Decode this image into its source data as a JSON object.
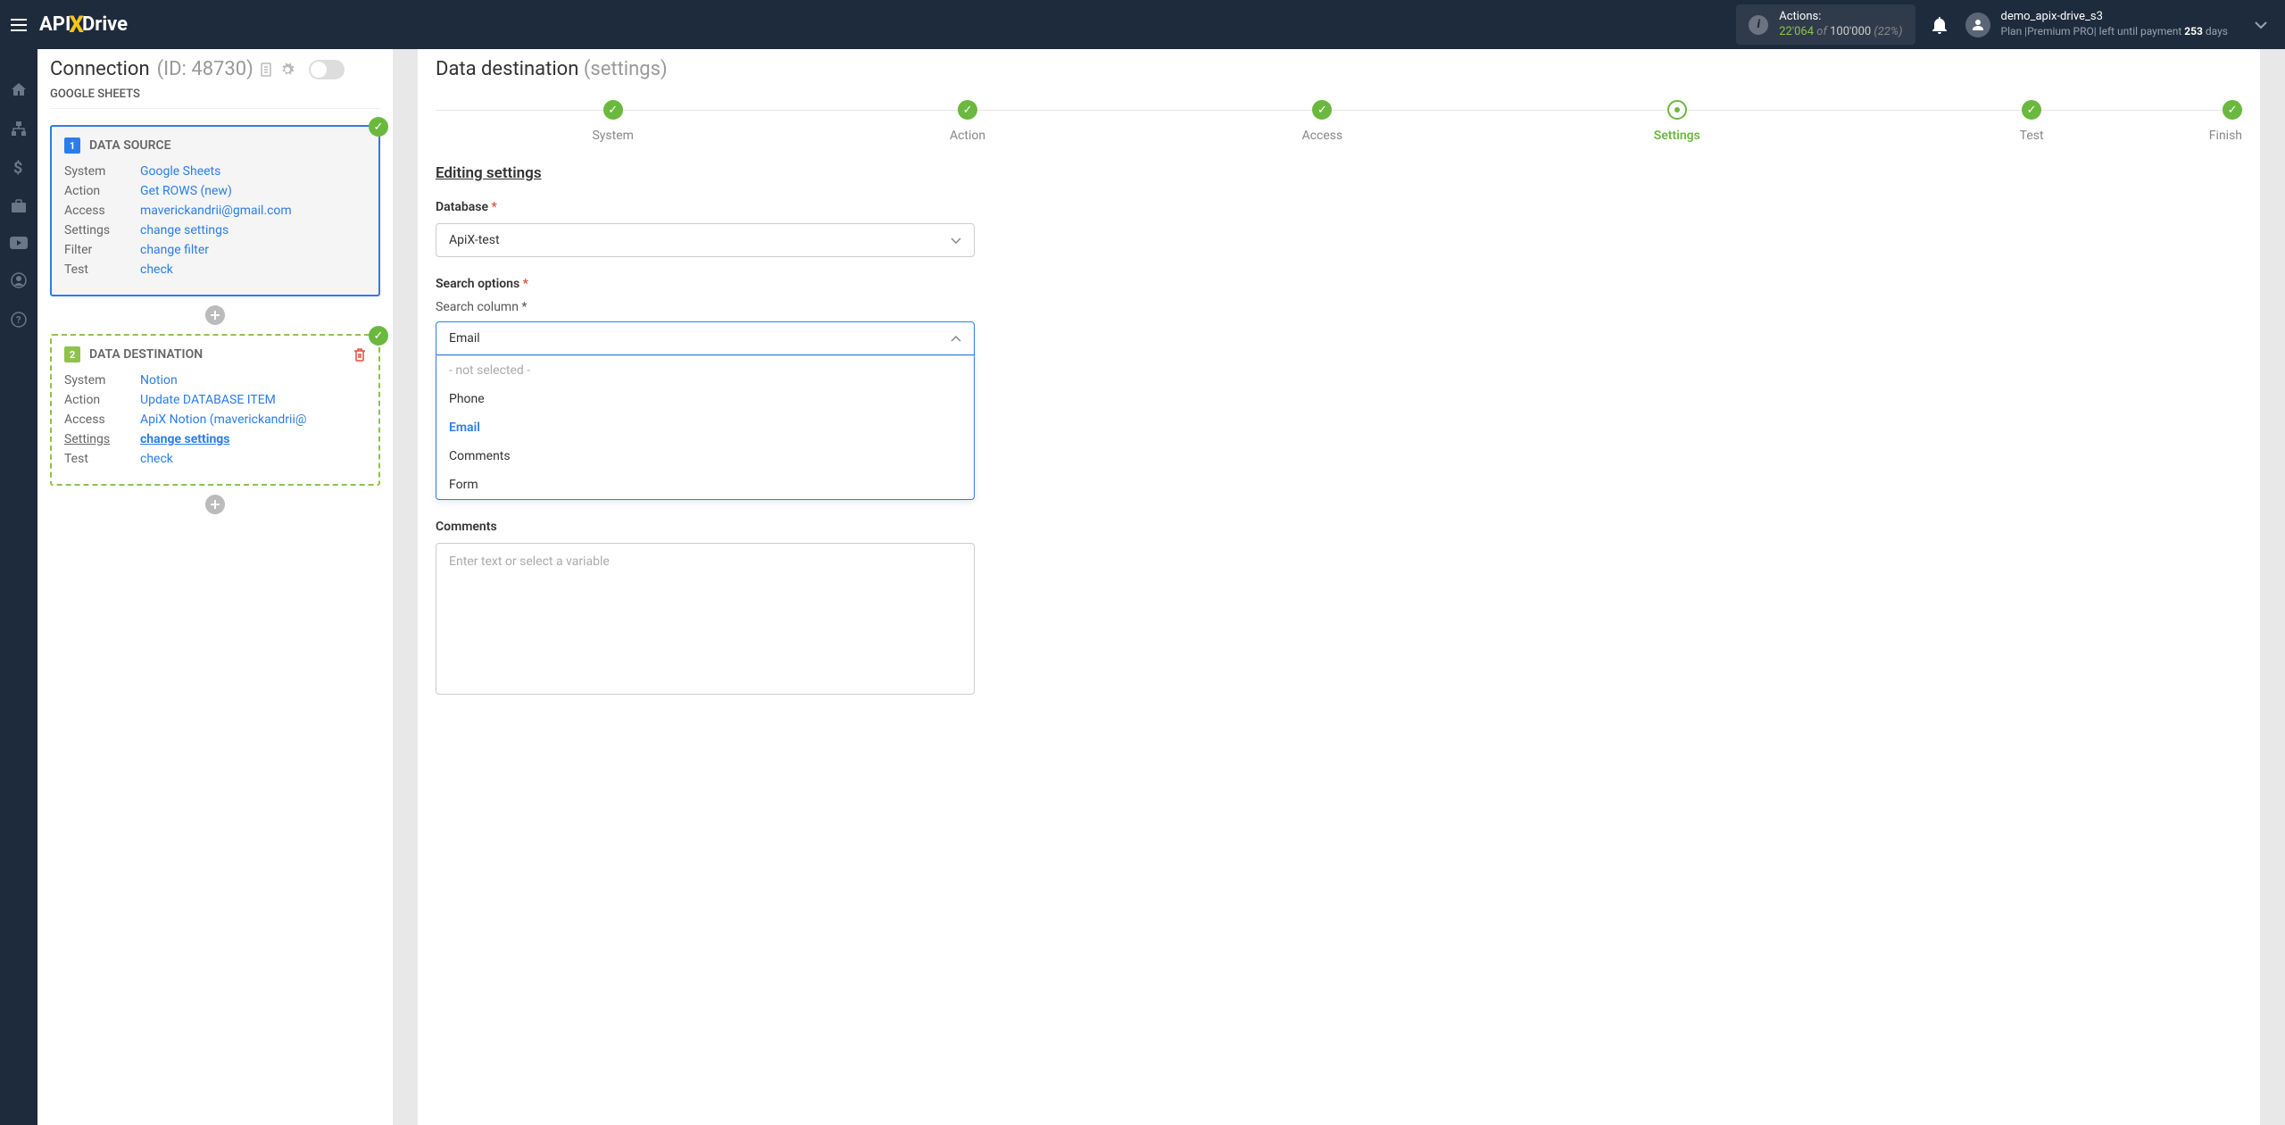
{
  "header": {
    "logo": {
      "api": "API",
      "x": "X",
      "drive": "Drive"
    },
    "actions": {
      "label": "Actions:",
      "used": "22'064",
      "of": "of",
      "total": "100'000",
      "pct": "(22%)"
    },
    "user": {
      "name": "demo_apix-drive_s3",
      "plan_prefix": "Plan |Premium PRO| left until payment ",
      "days": "253",
      "days_suffix": " days"
    }
  },
  "connection": {
    "title": "Connection",
    "id": "(ID: 48730)",
    "sheets": "GOOGLE SHEETS",
    "source": {
      "num": "1",
      "title": "DATA SOURCE",
      "rows": [
        {
          "label": "System",
          "value": "Google Sheets"
        },
        {
          "label": "Action",
          "value": "Get ROWS (new)"
        },
        {
          "label": "Access",
          "value": "maverickandrii@gmail.com"
        },
        {
          "label": "Settings",
          "value": "change settings"
        },
        {
          "label": "Filter",
          "value": "change filter"
        },
        {
          "label": "Test",
          "value": "check"
        }
      ]
    },
    "dest": {
      "num": "2",
      "title": "DATA DESTINATION",
      "rows": [
        {
          "label": "System",
          "value": "Notion"
        },
        {
          "label": "Action",
          "value": "Update DATABASE ITEM"
        },
        {
          "label": "Access",
          "value": "ApiX Notion (maverickandrii@"
        },
        {
          "label": "Settings",
          "value": "change settings"
        },
        {
          "label": "Test",
          "value": "check"
        }
      ]
    }
  },
  "destPanel": {
    "title": "Data destination",
    "subtitle": "(settings)",
    "steps": [
      {
        "label": "System",
        "state": "done"
      },
      {
        "label": "Action",
        "state": "done"
      },
      {
        "label": "Access",
        "state": "done"
      },
      {
        "label": "Settings",
        "state": "current"
      },
      {
        "label": "Test",
        "state": "done"
      },
      {
        "label": "Finish",
        "state": "done"
      }
    ],
    "sectionTitle": "Editing settings",
    "database": {
      "label": "Database",
      "value": "ApiX-test"
    },
    "searchOptions": {
      "label": "Search options"
    },
    "searchColumn": {
      "label": "Search column *",
      "value": "Email",
      "options": [
        {
          "text": "- not selected -",
          "type": "placeholder"
        },
        {
          "text": "Phone",
          "type": "normal"
        },
        {
          "text": "Email",
          "type": "selected"
        },
        {
          "text": "Comments",
          "type": "normal"
        },
        {
          "text": "Form",
          "type": "normal"
        }
      ]
    },
    "comments": {
      "label": "Comments",
      "placeholder": "Enter text or select a variable"
    }
  }
}
